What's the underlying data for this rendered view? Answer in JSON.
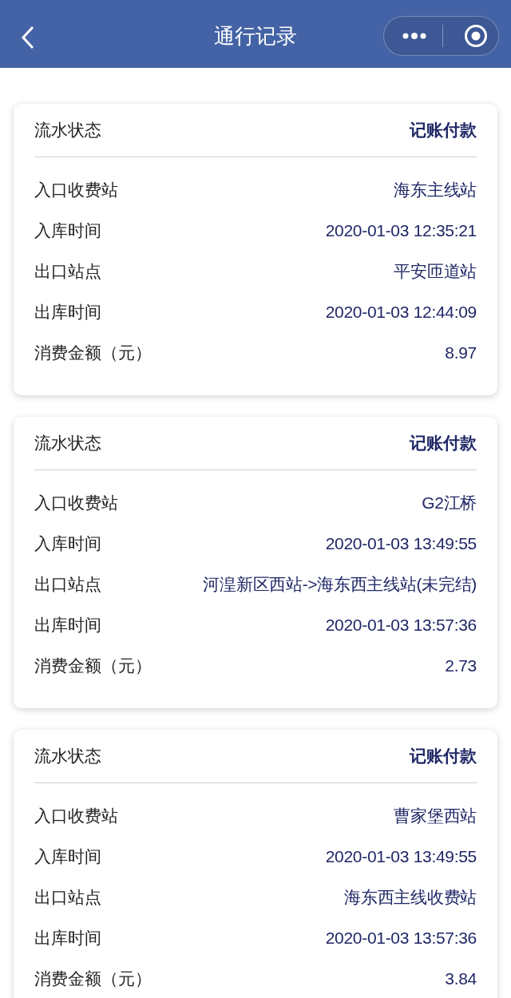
{
  "nav_bar": {
    "title": "通行记录"
  },
  "records": [
    {
      "status_label": "流水状态",
      "status": "记账付款",
      "fields": [
        {
          "label": "入口收费站",
          "value": "海东主线站"
        },
        {
          "label": "入库时间",
          "value": "2020-01-03 12:35:21"
        },
        {
          "label": "出口站点",
          "value": "平安匝道站"
        },
        {
          "label": "出库时间",
          "value": "2020-01-03 12:44:09"
        },
        {
          "label": "消费金额（元）",
          "value": "8.97"
        }
      ]
    },
    {
      "status_label": "流水状态",
      "status": "记账付款",
      "fields": [
        {
          "label": "入口收费站",
          "value": "G2江桥"
        },
        {
          "label": "入库时间",
          "value": "2020-01-03 13:49:55"
        },
        {
          "label": "出口站点",
          "value": "河湟新区西站->海东西主线站(未完结)"
        },
        {
          "label": "出库时间",
          "value": "2020-01-03 13:57:36"
        },
        {
          "label": "消费金额（元）",
          "value": "2.73"
        }
      ]
    },
    {
      "status_label": "流水状态",
      "status": "记账付款",
      "fields": [
        {
          "label": "入口收费站",
          "value": "曹家堡西站"
        },
        {
          "label": "入库时间",
          "value": "2020-01-03 13:49:55"
        },
        {
          "label": "出口站点",
          "value": "海东西主线收费站"
        },
        {
          "label": "出库时间",
          "value": "2020-01-03 13:57:36"
        },
        {
          "label": "消费金额（元）",
          "value": "3.84"
        }
      ]
    }
  ]
}
